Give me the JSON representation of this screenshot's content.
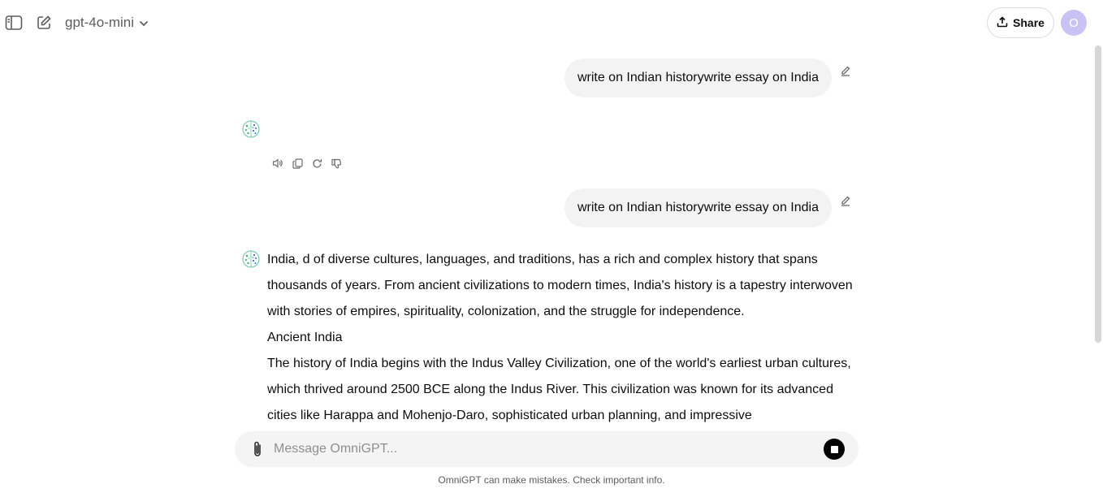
{
  "header": {
    "model_name": "gpt-4o-mini",
    "share_label": "Share",
    "avatar_initial": "O"
  },
  "messages": [
    {
      "role": "user",
      "text": "write on Indian historywrite essay on India"
    },
    {
      "role": "assistant",
      "text": ""
    },
    {
      "role": "user",
      "text": "write on Indian historywrite essay on India"
    },
    {
      "role": "assistant",
      "paragraphs": [
        "India, d of diverse cultures, languages, and traditions, has a rich and complex history that spans thousands of years. From ancient civilizations to modern times, India's history is a tapestry interwoven with stories of empires, spirituality, colonization, and the struggle for independence.",
        "Ancient India",
        "The history of India begins with the Indus Valley Civilization, one of the world's earliest urban cultures, which thrived around 2500 BCE along the Indus River. This civilization was known for its advanced cities like Harappa and Mohenjo-Daro, sophisticated urban planning, and impressive"
      ]
    }
  ],
  "composer": {
    "placeholder": "Message OmniGPT..."
  },
  "footer": {
    "note": "OmniGPT can make mistakes. Check important info."
  },
  "icons": {
    "sidebar_toggle": "sidebar-toggle-icon",
    "new_chat": "new-chat-icon",
    "chevron": "chevron-down-icon",
    "share": "share-icon",
    "edit": "pencil-icon",
    "assistant_logo": "brain-logo-icon",
    "speaker": "speaker-icon",
    "copy": "copy-icon",
    "regenerate": "regenerate-icon",
    "thumbs_down": "thumbs-down-icon",
    "attach": "paperclip-icon",
    "stop": "stop-icon"
  },
  "colors": {
    "avatar_bg": "#c9c3f5",
    "bubble_bg": "#f3f3f3",
    "composer_bg": "#f4f4f4",
    "stop_btn": "#000000"
  }
}
